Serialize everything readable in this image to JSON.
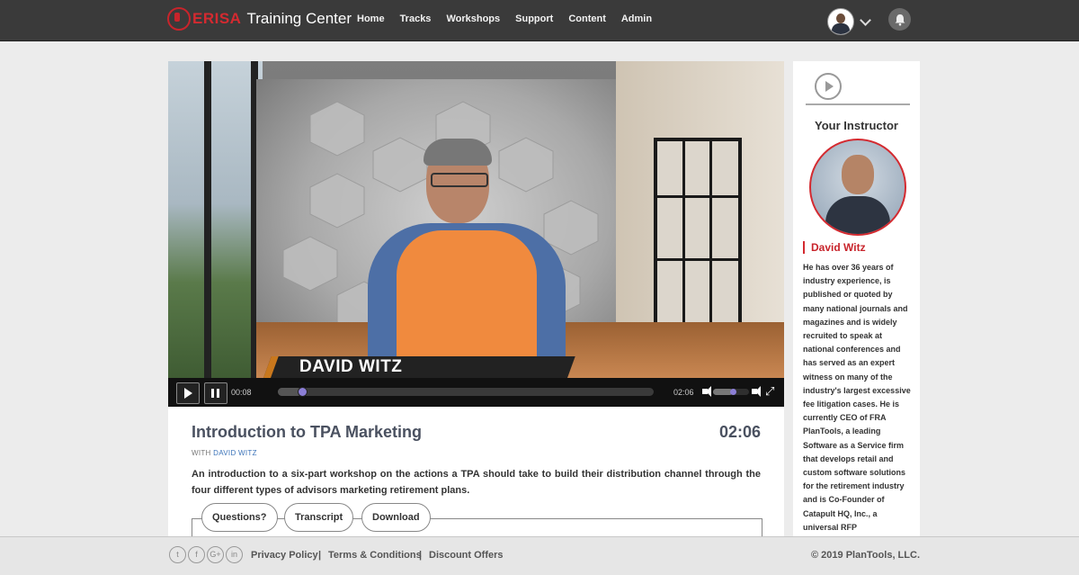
{
  "header": {
    "logo_brand": "ERISA",
    "logo_text": "Training Center",
    "nav": [
      "Home",
      "Tracks",
      "Workshops",
      "Support",
      "Content",
      "Admin"
    ]
  },
  "video": {
    "lower_third_name": "DAVID WITZ",
    "current_time": "00:08",
    "duration_time": "02:06",
    "progress": 0.063,
    "volume": 0.55
  },
  "lesson": {
    "title": "Introduction to TPA Marketing",
    "duration": "02:06",
    "with_label": "WITH",
    "instructor": "DAVID WITZ",
    "description": "An introduction to a six-part workshop on the actions a TPA should take to build their distribution channel through the four different types of advisors marketing retirement plans.",
    "tabs": [
      "Questions?",
      "Transcript",
      "Download"
    ]
  },
  "sidebar": {
    "heading": "Your Instructor",
    "name": "David Witz",
    "bio": "He has over 36 years of industry experience, is published or quoted by many national journals and magazines and is widely recruited to speak at national conferences and has served as an expert witness on many of the industry's largest excessive fee litigation cases. He is currently CEO of FRA PlanTools, a leading Software as a Service firm that develops retail and custom software solutions for the retirement industry and is Co-Founder of Catapult HQ, Inc., a universal RFP"
  },
  "footer": {
    "social": [
      "twitter-icon",
      "facebook-icon",
      "googleplus-icon",
      "linkedin-icon"
    ],
    "links": [
      "Privacy Policy",
      "Terms & Conditions",
      "Discount Offers"
    ],
    "copyright": "© 2019 PlanTools, LLC."
  },
  "colors": {
    "brand_red": "#d42a30",
    "topbar": "#3a3a3a",
    "link_blue": "#3b73b9"
  }
}
